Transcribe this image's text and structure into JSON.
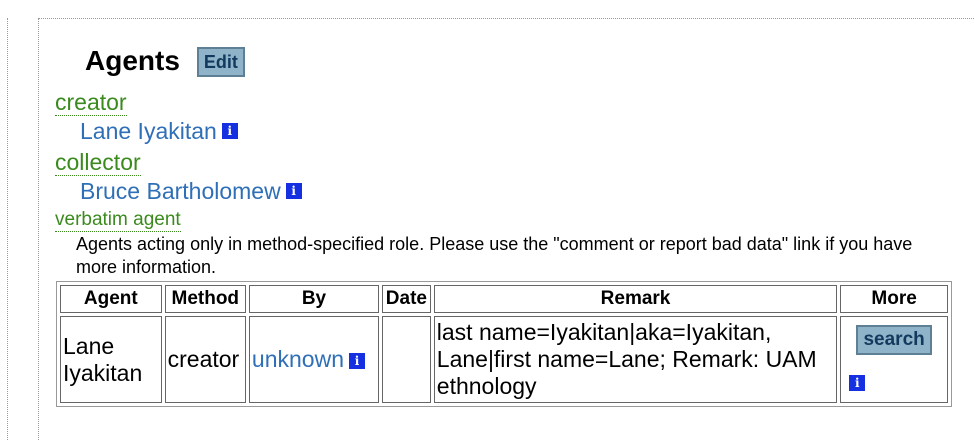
{
  "section": {
    "title": "Agents",
    "edit_label": "Edit"
  },
  "roles": [
    {
      "role": "creator",
      "agent": "Lane Iyakitan"
    },
    {
      "role": "collector",
      "agent": "Bruce Bartholomew"
    }
  ],
  "verbatim": {
    "role": "verbatim agent",
    "note": "Agents acting only in method-specified role. Please use the \"comment or report bad data\" link if you have more information."
  },
  "table": {
    "headers": [
      "Agent",
      "Method",
      "By",
      "Date",
      "Remark",
      "More"
    ],
    "rows": [
      {
        "agent": "Lane Iyakitan",
        "method": "creator",
        "by": "unknown",
        "date": "",
        "remark": "last name=Iyakitan|aka=Iyakitan, Lane|first name=Lane; Remark: UAM ethnology",
        "more_label": "search"
      }
    ]
  },
  "icons": {
    "info": "info-icon",
    "info_glyph": "i"
  },
  "colors": {
    "role_green": "#3b8a1e",
    "link_blue": "#2f6fb7",
    "info_blue": "#1530e0",
    "button_bg": "#8fb3c8"
  }
}
